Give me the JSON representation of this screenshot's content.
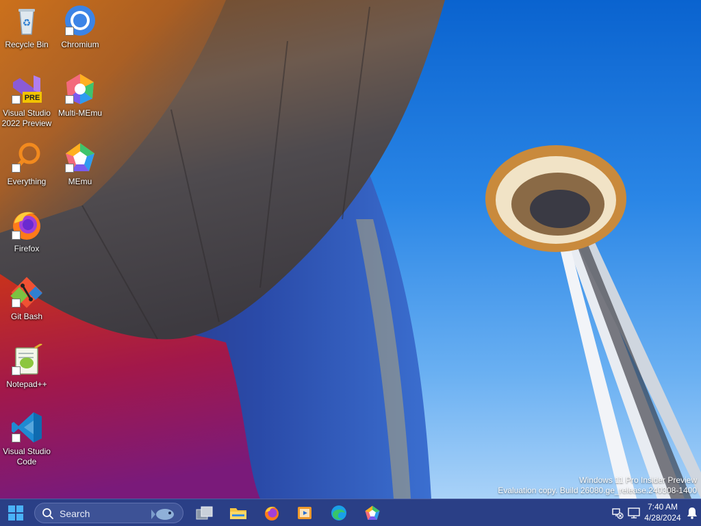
{
  "desktop": {
    "icons": [
      {
        "label": "Recycle Bin",
        "icon": "recycle-bin-icon"
      },
      {
        "label": "Chromium",
        "icon": "chromium-icon"
      },
      {
        "label": "Visual Studio\n2022 Preview",
        "icon": "visual-studio-preview-icon",
        "badge": "PRE"
      },
      {
        "label": "Multi-MEmu",
        "icon": "multi-memu-icon"
      },
      {
        "label": "Everything",
        "icon": "everything-search-icon"
      },
      {
        "label": "MEmu",
        "icon": "memu-icon"
      },
      {
        "label": "Firefox",
        "icon": "firefox-icon"
      },
      {
        "label": "Git Bash",
        "icon": "git-bash-icon"
      },
      {
        "label": "Notepad++",
        "icon": "notepad-plus-plus-icon"
      },
      {
        "label": "Visual Studio\nCode",
        "icon": "vscode-icon"
      }
    ],
    "watermark": {
      "line1": "Windows 11 Pro Insider Preview",
      "line2": "Evaluation copy. Build 26080.ge_release.240308-1400"
    }
  },
  "taskbar": {
    "search_placeholder": "Search",
    "pinned": [
      {
        "name": "task-view",
        "icon": "task-view-icon"
      },
      {
        "name": "file-explorer",
        "icon": "folder-icon"
      },
      {
        "name": "firefox",
        "icon": "firefox-icon"
      },
      {
        "name": "media-player",
        "icon": "media-player-icon"
      },
      {
        "name": "edge",
        "icon": "edge-icon"
      },
      {
        "name": "memu",
        "icon": "memu-icon"
      }
    ],
    "clock": {
      "time": "7:40 AM",
      "date": "4/28/2024"
    },
    "colors": {
      "taskbar": "#2a3f86",
      "accent": "#3b86e6"
    }
  }
}
